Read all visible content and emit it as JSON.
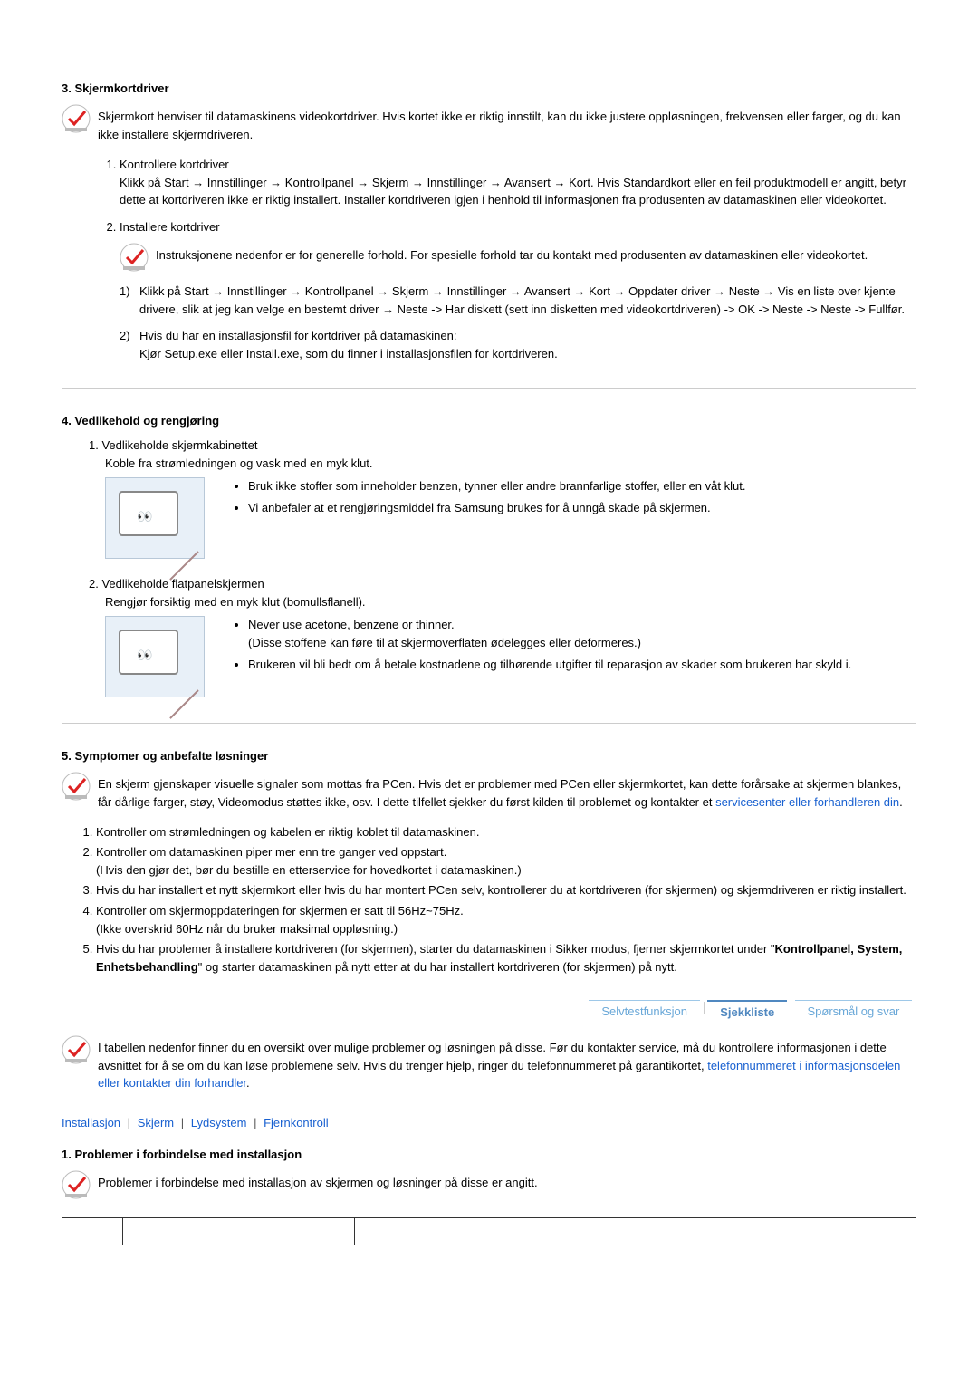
{
  "section3": {
    "title": "3. Skjermkortdriver",
    "intro": "Skjermkort henviser til datamaskinens videokortdriver. Hvis kortet ikke er riktig innstilt, kan du ikke justere oppløsningen, frekvensen eller farger, og du kan ikke installere skjermdriveren.",
    "item1_title": "Kontrollere kortdriver",
    "item1_body": "Klikk på Start → Innstillinger → Kontrollpanel → Skjerm → Innstillinger → Avansert → Kort. Hvis Standardkort eller en feil produktmodell er angitt, betyr dette at kortdriveren ikke er riktig installert. Installer kortdriveren igjen i henhold til informasjonen fra produsenten av datamaskinen eller videokortet.",
    "item2_title": "Installere kortdriver",
    "item2_note": "Instruksjonene nedenfor er for generelle forhold. For spesielle forhold tar du kontakt med produsenten av datamaskinen eller videokortet.",
    "sub1_marker": "1)",
    "sub1_text": "Klikk på Start → Innstillinger → Kontrollpanel → Skjerm → Innstillinger → Avansert → Kort → Oppdater driver → Neste → Vis en liste over kjente drivere, slik at jeg kan velge en bestemt driver → Neste -> Har diskett (sett inn disketten med videokortdriveren) -> OK -> Neste -> Neste -> Fullfør.",
    "sub2_marker": "2)",
    "sub2_text_a": "Hvis du har en installasjonsfil for kortdriver på datamaskinen:",
    "sub2_text_b": "Kjør Setup.exe eller Install.exe, som du finner i installasjonsfilen for kortdriveren."
  },
  "section4": {
    "title": "4. Vedlikehold og rengjøring",
    "item1_num": "1.",
    "item1_title": "Vedlikeholde skjermkabinettet",
    "item1_desc": "Koble fra strømledningen og vask med en myk klut.",
    "item1_b1": "Bruk ikke stoffer som inneholder benzen, tynner eller andre brannfarlige stoffer, eller en våt klut.",
    "item1_b2": "Vi anbefaler at et rengjøringsmiddel fra Samsung brukes for å unngå skade på skjermen.",
    "item2_num": "2.",
    "item2_title": "Vedlikeholde flatpanelskjermen",
    "item2_desc": "Rengjør forsiktig med en myk klut (bomullsflanell).",
    "item2_b1a": "Never use acetone, benzene or thinner.",
    "item2_b1b": "(Disse stoffene kan føre til at skjermoverflaten ødelegges eller deformeres.)",
    "item2_b2": "Brukeren vil bli bedt om å betale kostnadene og tilhørende utgifter til reparasjon av skader som brukeren har skyld i."
  },
  "section5": {
    "title": "5. Symptomer og anbefalte løsninger",
    "intro_a": "En skjerm gjenskaper visuelle signaler som mottas fra PCen. Hvis det er problemer med PCen eller skjermkortet, kan dette forårsake at skjermen blankes, får dårlige farger, støy, Videomodus støttes ikke, osv. I dette tilfellet sjekker du først kilden til problemet og kontakter et ",
    "intro_link": "servicesenter eller forhandleren din",
    "intro_b": ".",
    "li1": "Kontroller om strømledningen og kabelen er riktig koblet til datamaskinen.",
    "li2a": "Kontroller om datamaskinen piper mer enn tre ganger ved oppstart.",
    "li2b": "(Hvis den gjør det, bør du bestille en etterservice for hovedkortet i datamaskinen.)",
    "li3": "Hvis du har installert et nytt skjermkort eller hvis du har montert PCen selv, kontrollerer du at kortdriveren (for skjermen) og skjermdriveren er riktig installert.",
    "li4a": "Kontroller om skjermoppdateringen for skjermen er satt til 56Hz~75Hz.",
    "li4b": "(Ikke overskrid 60Hz når du bruker maksimal oppløsning.)",
    "li5a": "Hvis du har problemer å installere kortdriveren (for skjermen), starter du datamaskinen i Sikker modus, fjerner skjermkortet under \"",
    "li5bold": "Kontrollpanel, System, Enhetsbehandling",
    "li5b": "\" og starter datamaskinen på nytt etter at du har installert kortdriveren (for skjermen) på nytt."
  },
  "tabs": {
    "t1": "Selvtestfunksjon",
    "t2": "Sjekkliste",
    "t3": "Spørsmål og svar"
  },
  "checklist": {
    "intro_a": "I tabellen nedenfor finner du en oversikt over mulige problemer og løsningen på disse. Før du kontakter service, må du kontrollere informasjonen i dette avsnittet for å se om du kan løse problemene selv. Hvis du trenger hjelp, ringer du telefonnummeret på garantikortet, ",
    "intro_link": "telefonnummeret i informasjonsdelen eller kontakter din forhandler",
    "intro_b": "."
  },
  "links": {
    "l1": "Installasjon",
    "l2": "Skjerm",
    "l3": "Lydsystem",
    "l4": "Fjernkontroll"
  },
  "section_install": {
    "title": "1. Problemer i forbindelse med installasjon",
    "intro": "Problemer i forbindelse med installasjon av skjermen og løsninger på disse er angitt."
  }
}
